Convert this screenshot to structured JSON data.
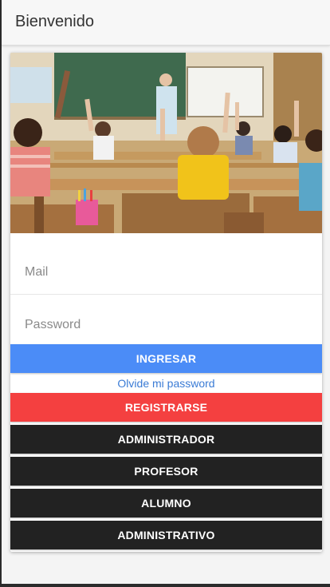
{
  "header": {
    "title": "Bienvenido"
  },
  "login": {
    "mail_placeholder": "Mail",
    "password_placeholder": "Password",
    "login_button": "INGRESAR",
    "forgot_link": "Olvide mi password",
    "register_button": "REGISTRARSE"
  },
  "roles": [
    {
      "label": "ADMINISTRADOR"
    },
    {
      "label": "PROFESOR"
    },
    {
      "label": "ALUMNO"
    },
    {
      "label": "ADMINISTRATIVO"
    }
  ],
  "colors": {
    "primary": "#4b8cf7",
    "danger": "#f44040",
    "dark": "#222222",
    "link": "#3a7bd5"
  }
}
